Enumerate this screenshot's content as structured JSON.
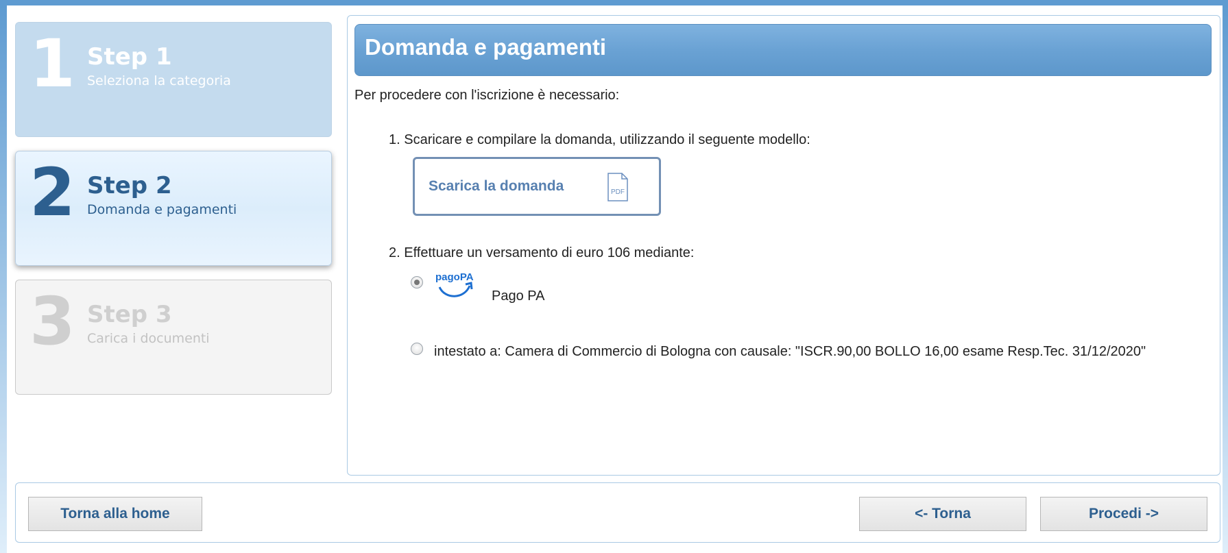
{
  "steps": [
    {
      "number": "1",
      "title": "Step 1",
      "subtitle": "Seleziona la categoria"
    },
    {
      "number": "2",
      "title": "Step 2",
      "subtitle": "Domanda e pagamenti"
    },
    {
      "number": "3",
      "title": "Step 3",
      "subtitle": "Carica i documenti"
    }
  ],
  "main": {
    "title": "Domanda e pagamenti",
    "intro": "Per procedere con l'iscrizione è necessario:",
    "item1": "1. Scaricare e compilare la domanda, utilizzando il seguente modello:",
    "download_label": "Scarica la domanda",
    "pdf_icon_text": "PDF",
    "item2": "2. Effettuare un versamento di euro 106 mediante:",
    "pagopa_logo_text": "pagoPA",
    "pagopa_label": "Pago PA",
    "bank_text": "intestato a: Camera di Commercio di Bologna con causale: \"ISCR.90,00 BOLLO 16,00 esame Resp.Tec. 31/12/2020\""
  },
  "footer": {
    "home_label": "Torna alla home",
    "back_label": "<- Torna",
    "next_label": "Procedi ->"
  },
  "colors": {
    "accent": "#5e9bd1",
    "step_active_text": "#2d5f8f",
    "button_text": "#2d5f8f"
  }
}
